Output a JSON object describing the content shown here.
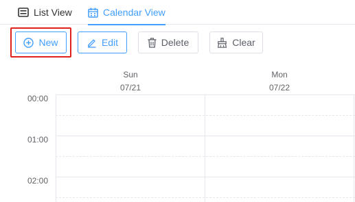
{
  "tabs": [
    {
      "label": "List View",
      "icon": "list-icon",
      "active": false
    },
    {
      "label": "Calendar View",
      "icon": "calendar-icon",
      "active": true
    }
  ],
  "toolbar": {
    "new_label": "New",
    "edit_label": "Edit",
    "delete_label": "Delete",
    "clear_label": "Clear"
  },
  "calendar": {
    "days": [
      {
        "weekday": "Sun",
        "date": "07/21"
      },
      {
        "weekday": "Mon",
        "date": "07/22"
      }
    ],
    "times": [
      "00:00",
      "01:00",
      "02:00"
    ]
  },
  "colors": {
    "accent": "#409eff",
    "highlight": "#e0201a",
    "border": "#dcdfe6"
  }
}
